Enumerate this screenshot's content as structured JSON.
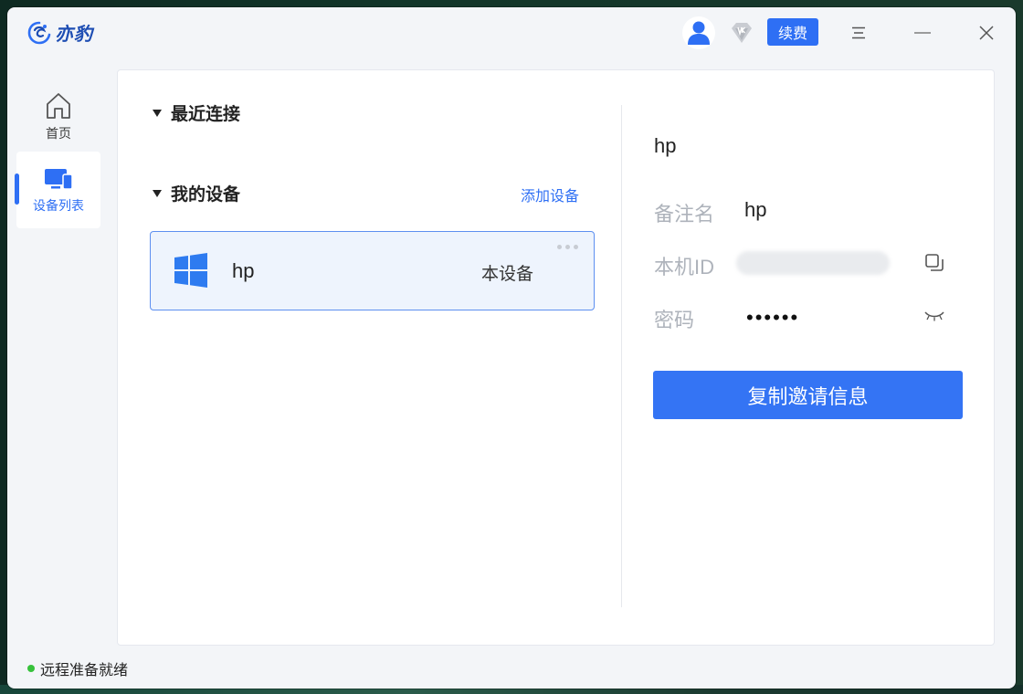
{
  "app": {
    "name": "亦豹",
    "brand_color": "#2e6ff4"
  },
  "titlebar": {
    "renew_label": "续费",
    "icons": [
      "user-avatar-icon",
      "vip-badge-icon",
      "menu-icon",
      "minimize-icon",
      "close-icon"
    ]
  },
  "sidebar": {
    "items": [
      {
        "label": "首页",
        "icon": "home-icon",
        "active": false
      },
      {
        "label": "设备列表",
        "icon": "devices-icon",
        "active": true
      }
    ]
  },
  "main": {
    "recent_title": "最近连接",
    "mine_title": "我的设备",
    "add_device_label": "添加设备",
    "devices": [
      {
        "name": "hp",
        "tag": "本设备",
        "os": "windows",
        "selected": true
      }
    ]
  },
  "detail": {
    "title": "hp",
    "remark_label": "备注名",
    "remark_value": "hp",
    "id_label": "本机ID",
    "password_label": "密码",
    "password_value": "••••••",
    "copy_invite_label": "复制邀请信息"
  },
  "status": {
    "text": "远程准备就绪",
    "color": "#37c23c"
  }
}
